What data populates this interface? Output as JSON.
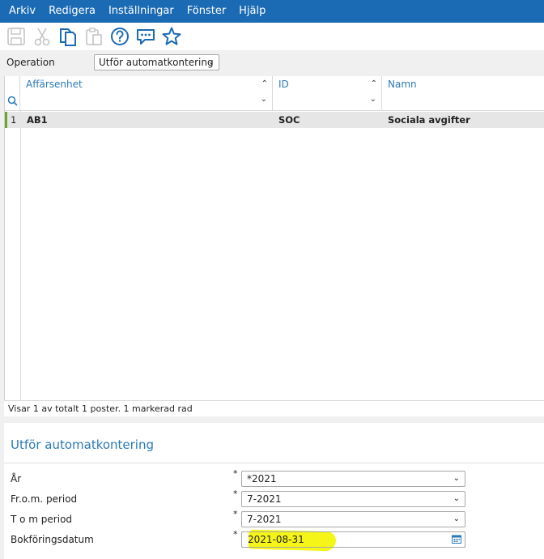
{
  "menu": [
    "Arkiv",
    "Redigera",
    "Inställningar",
    "Fönster",
    "Hjälp"
  ],
  "toolbar": {
    "icons": [
      "save-icon",
      "cut-icon",
      "copy-icon",
      "paste-icon",
      "help-icon",
      "chat-icon",
      "favorite-star-icon"
    ]
  },
  "operation": {
    "label": "Operation",
    "value": "Utför automatkontering"
  },
  "grid": {
    "columns": [
      "Affärsenhet",
      "ID",
      "Namn"
    ],
    "rows": [
      {
        "num": "1",
        "affarsenhet": "AB1",
        "id": "SOC",
        "namn": "Sociala avgifter"
      }
    ],
    "status": "Visar 1 av totalt 1 poster. 1 markerad rad"
  },
  "form": {
    "title": "Utför automatkontering",
    "fields": [
      {
        "label": "År",
        "value": "*2021"
      },
      {
        "label": "Fr.o.m. period",
        "value": "7-2021"
      },
      {
        "label": "T o m period",
        "value": "7-2021"
      },
      {
        "label": "Bokföringsdatum",
        "value": "2021-08-31"
      }
    ],
    "required_mark": "*"
  },
  "colors": {
    "menubar": "#1b6ab4",
    "accent": "#2a7ab8",
    "selection_marker": "#6aa62d",
    "highlight": "#f5f518"
  }
}
